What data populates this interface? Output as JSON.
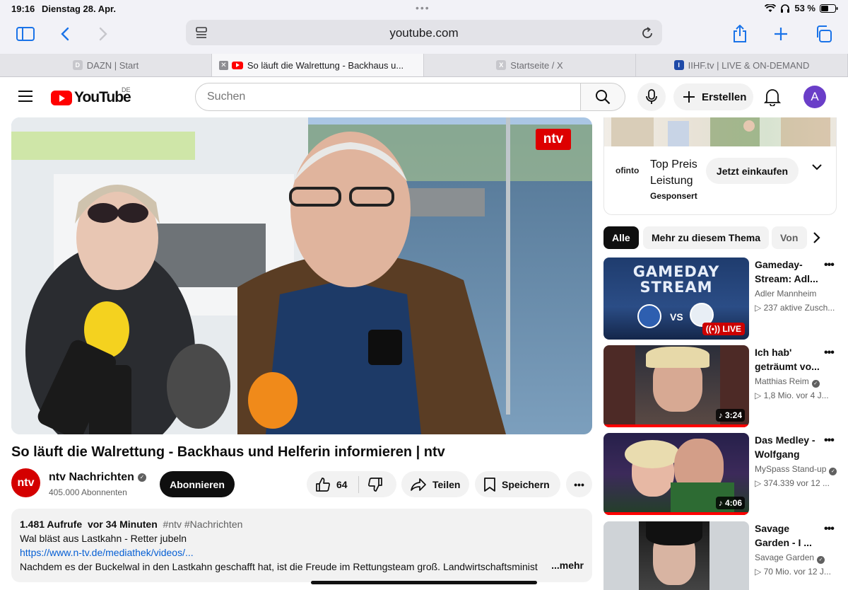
{
  "status": {
    "time": "19:16",
    "date": "Dienstag 28. Apr.",
    "battery": "53 %"
  },
  "safari": {
    "url": "youtube.com",
    "tabs": [
      {
        "label": "DAZN | Start",
        "favicon": "D"
      },
      {
        "label": "So läuft die Walrettung - Backhaus u...",
        "favicon": "yt"
      },
      {
        "label": "Startseite / X",
        "favicon": "X"
      },
      {
        "label": "IIHF.tv | LIVE & ON-DEMAND",
        "favicon": "I"
      }
    ]
  },
  "youtube": {
    "logo": "YouTube",
    "country": "DE",
    "search_placeholder": "Suchen",
    "create_label": "Erstellen",
    "avatar_letter": "A"
  },
  "video": {
    "overlay_logo": "ntv",
    "title": "So läuft die Walrettung - Backhaus und Helferin informieren | ntv",
    "channel": "ntv Nachrichten",
    "channel_logo": "ntv",
    "subscribers": "405.000 Abonnenten",
    "subscribe_label": "Abonnieren",
    "likes": "64",
    "share_label": "Teilen",
    "save_label": "Speichern",
    "more_label": "•••",
    "description": {
      "views": "1.481 Aufrufe",
      "age": "vor 34 Minuten",
      "tags": "#ntv #Nachrichten",
      "line2": "Wal bläst aus Lastkahn - Retter jubeln",
      "link": "https://www.n-tv.de/mediathek/videos/...",
      "line4": "Nachdem es der Buckelwal in den Lastkahn geschafft hat, ist die Freude im Rettungsteam groß. Landwirtschaftsminist",
      "more": "...mehr"
    }
  },
  "ad": {
    "brand": "ofinto",
    "line1": "Top Preis",
    "line2": "Leistung",
    "sponsored": "Gesponsert",
    "cta": "Jetzt einkaufen"
  },
  "chips": [
    "Alle",
    "Mehr zu diesem Thema",
    "Von"
  ],
  "recommendations": [
    {
      "title": "Gameday-Stream: Adl...",
      "channel": "Adler Mannheim",
      "stats": "▷ 237 aktive Zusch...",
      "badge": "LIVE",
      "thumb_text1": "GAMEDAY",
      "thumb_text2": "STREAM",
      "verified": false
    },
    {
      "title": "Ich hab' geträumt vo...",
      "channel": "Matthias Reim",
      "stats": "▷ 1,8 Mio.  vor 4 J...",
      "duration": "♪ 3:24",
      "verified": true
    },
    {
      "title": "Das Medley - Wolfgang un...",
      "channel": "MySpass Stand-up",
      "stats": "▷ 374.339  vor 12 ...",
      "duration": "♪ 4:06",
      "verified": true
    },
    {
      "title": "Savage Garden - I ...",
      "channel": "Savage Garden",
      "stats": "▷ 70 Mio.  vor 12 J...",
      "verified": true
    }
  ]
}
